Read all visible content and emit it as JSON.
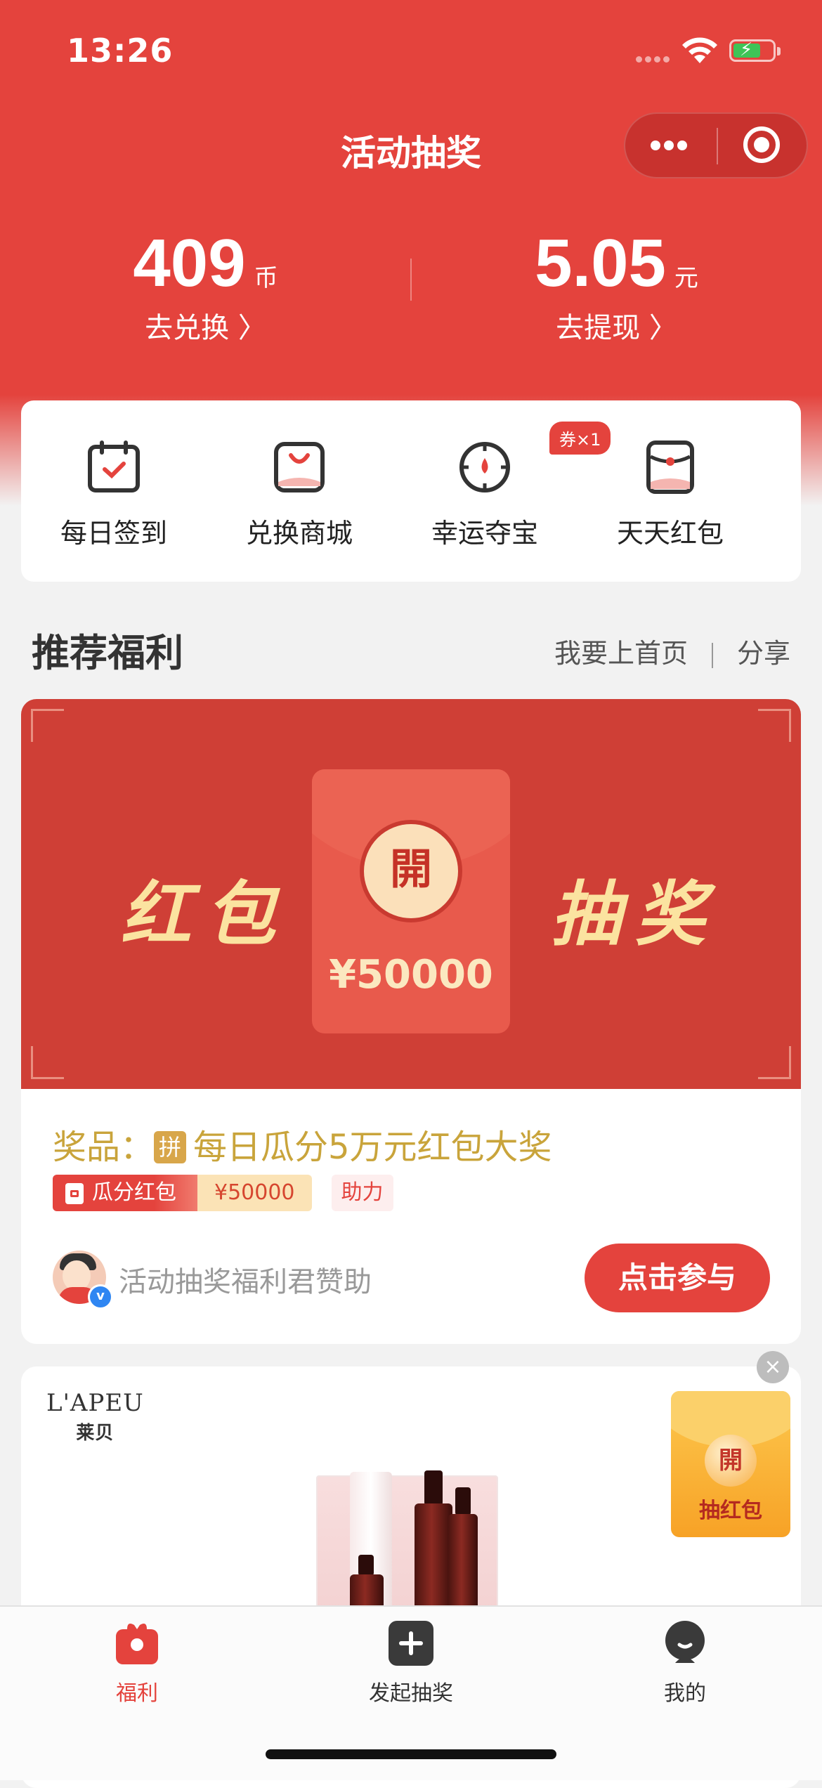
{
  "status_bar": {
    "time": "13:26"
  },
  "nav": {
    "title": "活动抽奖"
  },
  "stats": {
    "coins": {
      "value": "409",
      "unit": "币",
      "link": "去兑换 〉"
    },
    "cash": {
      "value": "5.05",
      "unit": "元",
      "link": "去提现 〉"
    }
  },
  "quick_actions": {
    "items": [
      {
        "label": "每日签到",
        "icon": "calendar-check-icon"
      },
      {
        "label": "兑换商城",
        "icon": "shopping-bag-icon"
      },
      {
        "label": "幸运夺宝",
        "icon": "lucky-wheel-icon"
      },
      {
        "label": "天天红包",
        "icon": "red-envelope-icon"
      }
    ],
    "badge": "券×1"
  },
  "section": {
    "title": "推荐福利",
    "link_home": "我要上首页",
    "link_share": "分享"
  },
  "promo": {
    "banner_left": "红包",
    "banner_right": "抽奖",
    "seal": "開",
    "amount": "¥50000",
    "prize_prefix": "奖品：",
    "prize_tag": "拼",
    "prize_name": "每日瓜分5万元红包大奖",
    "tag_type": "瓜分红包",
    "tag_amount": "¥50000",
    "tag_help": "助力",
    "sponsor": "活动抽奖福利君赞助",
    "join_button": "点击参与"
  },
  "ad": {
    "brand": "L'APEU",
    "brand_cn": "莱贝",
    "close": "×"
  },
  "float_redpack": {
    "seal": "開",
    "label": "抽红包"
  },
  "tabbar": {
    "items": [
      {
        "label": "福利",
        "icon": "gift-icon",
        "active": true
      },
      {
        "label": "发起抽奖",
        "icon": "plus-square-icon",
        "active": false
      },
      {
        "label": "我的",
        "icon": "profile-icon",
        "active": false
      }
    ]
  },
  "colors": {
    "primary": "#e4433d",
    "gold_text": "#c9a43b",
    "banner": "#cf3f36"
  }
}
